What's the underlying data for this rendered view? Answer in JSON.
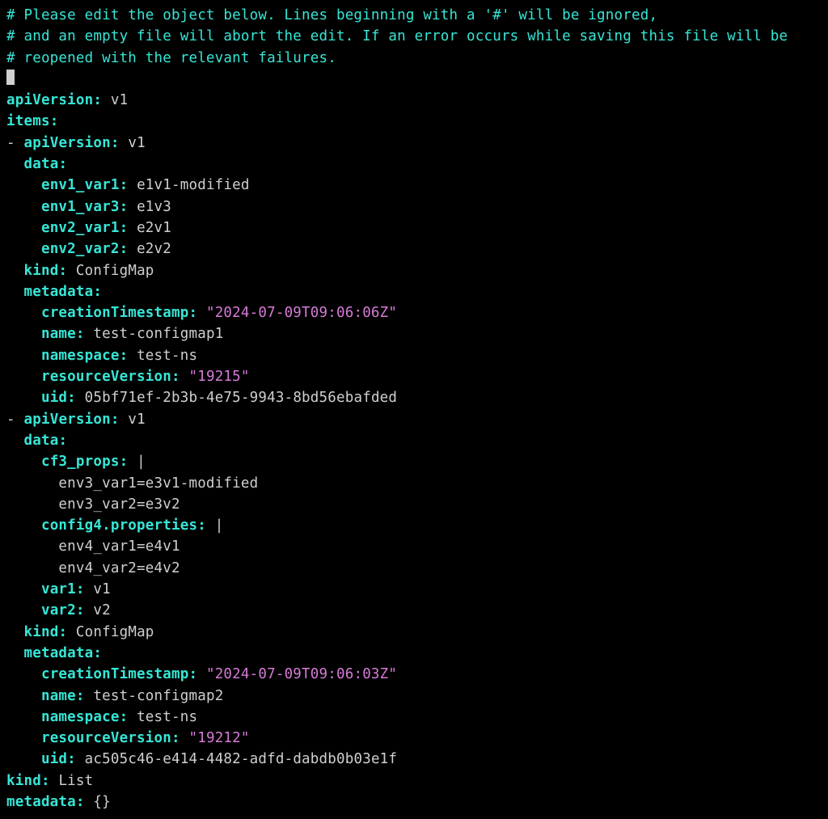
{
  "comments": {
    "l1": "# Please edit the object below. Lines beginning with a '#' will be ignored,",
    "l2": "# and an empty file will abort the edit. If an error occurs while saving this file will be",
    "l3": "# reopened with the relevant failures."
  },
  "top": {
    "apiVersion_key": "apiVersion",
    "apiVersion_val": "v1",
    "items_key": "items",
    "kind_key": "kind",
    "kind_val": "List",
    "metadata_key": "metadata",
    "metadata_val": "{}"
  },
  "item0": {
    "apiVersion_key": "apiVersion",
    "apiVersion_val": "v1",
    "data_key": "data",
    "env1_var1_key": "env1_var1",
    "env1_var1_val": "e1v1-modified",
    "env1_var3_key": "env1_var3",
    "env1_var3_val": "e1v3",
    "env2_var1_key": "env2_var1",
    "env2_var1_val": "e2v1",
    "env2_var2_key": "env2_var2",
    "env2_var2_val": "e2v2",
    "kind_key": "kind",
    "kind_val": "ConfigMap",
    "metadata_key": "metadata",
    "creationTimestamp_key": "creationTimestamp",
    "creationTimestamp_val": "\"2024-07-09T09:06:06Z\"",
    "name_key": "name",
    "name_val": "test-configmap1",
    "namespace_key": "namespace",
    "namespace_val": "test-ns",
    "resourceVersion_key": "resourceVersion",
    "resourceVersion_val": "\"19215\"",
    "uid_key": "uid",
    "uid_val": "05bf71ef-2b3b-4e75-9943-8bd56ebafded"
  },
  "item1": {
    "apiVersion_key": "apiVersion",
    "apiVersion_val": "v1",
    "data_key": "data",
    "cf3_props_key": "cf3_props",
    "cf3_props_pipe": "|",
    "cf3_line1": "env3_var1=e3v1-modified",
    "cf3_line2": "env3_var2=e3v2",
    "config4_key": "config4.properties",
    "config4_pipe": "|",
    "config4_line1": "env4_var1=e4v1",
    "config4_line2": "env4_var2=e4v2",
    "var1_key": "var1",
    "var1_val": "v1",
    "var2_key": "var2",
    "var2_val": "v2",
    "kind_key": "kind",
    "kind_val": "ConfigMap",
    "metadata_key": "metadata",
    "creationTimestamp_key": "creationTimestamp",
    "creationTimestamp_val": "\"2024-07-09T09:06:03Z\"",
    "name_key": "name",
    "name_val": "test-configmap2",
    "namespace_key": "namespace",
    "namespace_val": "test-ns",
    "resourceVersion_key": "resourceVersion",
    "resourceVersion_val": "\"19212\"",
    "uid_key": "uid",
    "uid_val": "ac505c46-e414-4482-adfd-dabdb0b03e1f"
  },
  "punct": {
    "dash": "-",
    "colon": ":",
    "colon_sp": ": "
  }
}
